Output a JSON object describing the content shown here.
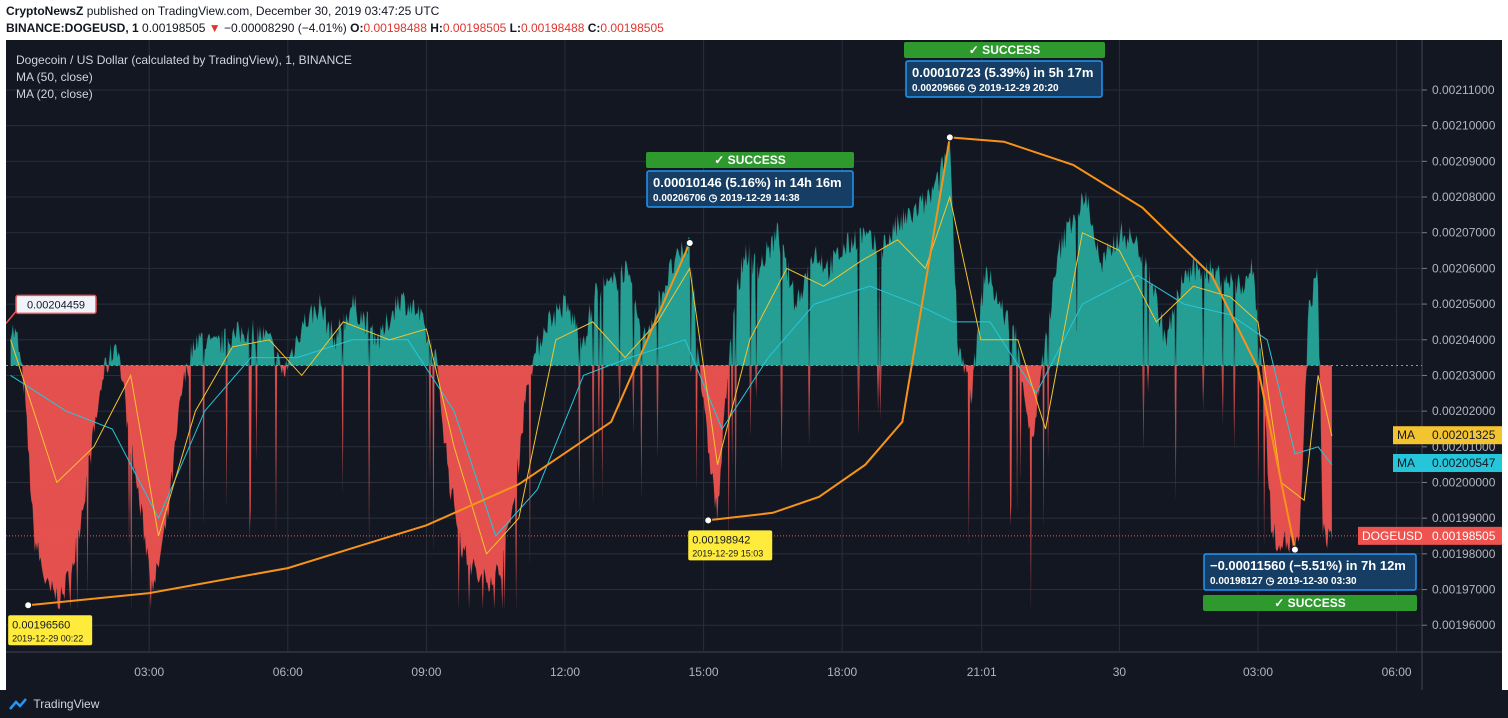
{
  "header": {
    "line1": {
      "author": "CryptoNewsZ",
      "published_text": "published on TradingView.com, December 30, 2019 03:47:25 UTC"
    },
    "line2": {
      "symbol": "BINANCE:DOGEUSD, 1",
      "last": "0.00198505",
      "arrow": "▼",
      "change": "−0.00008290 (−4.01%)",
      "o_label": "O:",
      "o_val": "0.00198488",
      "h_label": "H:",
      "h_val": "0.00198505",
      "l_label": "L:",
      "l_val": "0.00198488",
      "c_label": "C:",
      "c_val": "0.00198505"
    }
  },
  "legend": {
    "title": "Dogecoin / US Dollar (calculated by TradingView), 1, BINANCE",
    "ma1": "MA (50, close)",
    "ma2": "MA (20, close)"
  },
  "footer": {
    "brand": "TradingView"
  },
  "colors": {
    "background": "#131722",
    "grid": "#2a2e39",
    "up_fill": "#26a69a",
    "down_fill": "#ef5350",
    "ma50": "#26c6da",
    "ma20": "#f4c430",
    "trend": "#f7931a",
    "callout": "#163d63",
    "callout_border": "#2196f3",
    "success": "#2e9a2e",
    "yellow_label": "#ffeb3b"
  },
  "chart_data": {
    "type": "area",
    "baseline": 0.0020328,
    "ylim": [
      0.0019525,
      0.002124
    ],
    "xlim": [
      -0.1,
      30.55
    ],
    "y_ticks": [
      "0.00196000",
      "0.00197000",
      "0.00198000",
      "0.00199000",
      "0.00200000",
      "0.00201000",
      "0.00202000",
      "0.00203000",
      "0.00204000",
      "0.00205000",
      "0.00206000",
      "0.00207000",
      "0.00208000",
      "0.00209000",
      "0.00210000",
      "0.00211000"
    ],
    "x_ticks": [
      {
        "label": "03:00",
        "h": 3
      },
      {
        "label": "06:00",
        "h": 6
      },
      {
        "label": "09:00",
        "h": 9
      },
      {
        "label": "12:00",
        "h": 12
      },
      {
        "label": "15:00",
        "h": 15
      },
      {
        "label": "18:00",
        "h": 18
      },
      {
        "label": "21:01",
        "h": 21.02
      },
      {
        "label": "30",
        "h": 24
      },
      {
        "label": "03:00",
        "h": 27
      },
      {
        "label": "06:00",
        "h": 30
      }
    ],
    "price_path": [
      [
        0.0,
        0.002044
      ],
      [
        0.15,
        0.00204
      ],
      [
        0.3,
        0.002025
      ],
      [
        0.5,
        0.001985
      ],
      [
        0.8,
        0.00197
      ],
      [
        1.1,
        0.001967
      ],
      [
        1.4,
        0.00198
      ],
      [
        1.7,
        0.002005
      ],
      [
        2.0,
        0.00203
      ],
      [
        2.3,
        0.00204
      ],
      [
        2.6,
        0.00201
      ],
      [
        2.9,
        0.001985
      ],
      [
        3.1,
        0.00197
      ],
      [
        3.4,
        0.00199
      ],
      [
        3.7,
        0.002025
      ],
      [
        4.0,
        0.002041
      ],
      [
        4.4,
        0.002038
      ],
      [
        4.8,
        0.002041
      ],
      [
        5.2,
        0.002043
      ],
      [
        5.6,
        0.00204
      ],
      [
        5.9,
        0.00203
      ],
      [
        6.3,
        0.002044
      ],
      [
        6.7,
        0.00205
      ],
      [
        7.0,
        0.00204
      ],
      [
        7.4,
        0.00205
      ],
      [
        7.7,
        0.002045
      ],
      [
        8.0,
        0.00204
      ],
      [
        8.4,
        0.002052
      ],
      [
        8.8,
        0.002048
      ],
      [
        9.2,
        0.002035
      ],
      [
        9.5,
        0.002
      ],
      [
        9.8,
        0.00198
      ],
      [
        10.2,
        0.001972
      ],
      [
        10.6,
        0.001975
      ],
      [
        10.9,
        0.001995
      ],
      [
        11.2,
        0.00203
      ],
      [
        11.6,
        0.002045
      ],
      [
        12.0,
        0.00205
      ],
      [
        12.4,
        0.00204
      ],
      [
        12.7,
        0.002055
      ],
      [
        13.0,
        0.002055
      ],
      [
        13.3,
        0.00206
      ],
      [
        13.7,
        0.00204
      ],
      [
        14.0,
        0.00205
      ],
      [
        14.3,
        0.00206
      ],
      [
        14.7,
        0.002067
      ],
      [
        15.0,
        0.00202
      ],
      [
        15.3,
        0.00199
      ],
      [
        15.6,
        0.002045
      ],
      [
        15.9,
        0.002065
      ],
      [
        16.2,
        0.00206
      ],
      [
        16.6,
        0.00207
      ],
      [
        17.0,
        0.00205
      ],
      [
        17.4,
        0.002065
      ],
      [
        17.7,
        0.00206
      ],
      [
        18.0,
        0.002065
      ],
      [
        18.4,
        0.00207
      ],
      [
        18.8,
        0.002065
      ],
      [
        19.2,
        0.002072
      ],
      [
        19.5,
        0.002075
      ],
      [
        19.9,
        0.00208
      ],
      [
        20.1,
        0.002085
      ],
      [
        20.33,
        0.002097
      ],
      [
        20.5,
        0.00204
      ],
      [
        20.8,
        0.002025
      ],
      [
        21.1,
        0.00206
      ],
      [
        21.4,
        0.00205
      ],
      [
        21.8,
        0.00204
      ],
      [
        22.1,
        0.00201
      ],
      [
        22.4,
        0.00204
      ],
      [
        22.7,
        0.002065
      ],
      [
        23.0,
        0.002075
      ],
      [
        23.3,
        0.00208
      ],
      [
        23.6,
        0.00206
      ],
      [
        24.0,
        0.00207
      ],
      [
        24.3,
        0.002068
      ],
      [
        24.6,
        0.002062
      ],
      [
        25.0,
        0.00204
      ],
      [
        25.4,
        0.002058
      ],
      [
        25.8,
        0.00206
      ],
      [
        26.2,
        0.002058
      ],
      [
        26.6,
        0.002055
      ],
      [
        26.9,
        0.00206
      ],
      [
        27.1,
        0.00203
      ],
      [
        27.3,
        0.001985
      ],
      [
        27.6,
        0.001983
      ],
      [
        27.9,
        0.001982
      ],
      [
        28.1,
        0.00205
      ],
      [
        28.3,
        0.002058
      ],
      [
        28.4,
        0.001985
      ],
      [
        28.6,
        0.001985
      ]
    ],
    "ma20_path": [
      [
        0.0,
        0.00204
      ],
      [
        1.0,
        0.002
      ],
      [
        1.8,
        0.00201
      ],
      [
        2.6,
        0.00203
      ],
      [
        3.2,
        0.001985
      ],
      [
        4.0,
        0.00202
      ],
      [
        4.8,
        0.002038
      ],
      [
        5.6,
        0.00204
      ],
      [
        6.3,
        0.00203
      ],
      [
        7.2,
        0.002045
      ],
      [
        8.2,
        0.00204
      ],
      [
        9.0,
        0.002043
      ],
      [
        9.6,
        0.00201
      ],
      [
        10.3,
        0.00198
      ],
      [
        11.0,
        0.00199
      ],
      [
        11.8,
        0.00204
      ],
      [
        12.6,
        0.002045
      ],
      [
        13.3,
        0.002035
      ],
      [
        14.0,
        0.002045
      ],
      [
        14.7,
        0.00206
      ],
      [
        15.3,
        0.002005
      ],
      [
        16.0,
        0.00204
      ],
      [
        16.8,
        0.00206
      ],
      [
        17.6,
        0.002055
      ],
      [
        18.4,
        0.002062
      ],
      [
        19.2,
        0.002068
      ],
      [
        19.8,
        0.00206
      ],
      [
        20.33,
        0.00208
      ],
      [
        21.0,
        0.00204
      ],
      [
        21.8,
        0.00204
      ],
      [
        22.4,
        0.002015
      ],
      [
        23.2,
        0.00207
      ],
      [
        24.0,
        0.002065
      ],
      [
        24.8,
        0.002045
      ],
      [
        25.6,
        0.002055
      ],
      [
        26.4,
        0.002052
      ],
      [
        27.0,
        0.002045
      ],
      [
        27.5,
        0.002
      ],
      [
        28.0,
        0.001995
      ],
      [
        28.3,
        0.00203
      ],
      [
        28.6,
        0.002013
      ]
    ],
    "ma50_path": [
      [
        0.0,
        0.00203
      ],
      [
        1.2,
        0.00202
      ],
      [
        2.2,
        0.002015
      ],
      [
        3.2,
        0.00199
      ],
      [
        4.2,
        0.00202
      ],
      [
        5.2,
        0.002035
      ],
      [
        6.2,
        0.002035
      ],
      [
        7.4,
        0.00204
      ],
      [
        8.6,
        0.00204
      ],
      [
        9.6,
        0.00202
      ],
      [
        10.5,
        0.001985
      ],
      [
        11.4,
        0.001998
      ],
      [
        12.4,
        0.00203
      ],
      [
        13.4,
        0.002035
      ],
      [
        14.6,
        0.00204
      ],
      [
        15.4,
        0.002015
      ],
      [
        16.4,
        0.002035
      ],
      [
        17.4,
        0.00205
      ],
      [
        18.6,
        0.002055
      ],
      [
        19.6,
        0.00205
      ],
      [
        20.4,
        0.002045
      ],
      [
        21.2,
        0.002045
      ],
      [
        22.2,
        0.002025
      ],
      [
        23.2,
        0.00205
      ],
      [
        24.4,
        0.002058
      ],
      [
        25.4,
        0.00205
      ],
      [
        26.4,
        0.002047
      ],
      [
        27.2,
        0.00204
      ],
      [
        27.8,
        0.002008
      ],
      [
        28.3,
        0.00201
      ],
      [
        28.6,
        0.002005
      ]
    ],
    "trend_segments": [
      [
        [
          0.38,
          0.0019656
        ],
        [
          3.0,
          0.001969
        ],
        [
          6.0,
          0.001976
        ],
        [
          9.0,
          0.001988
        ],
        [
          11.0,
          0.0019995
        ],
        [
          13.0,
          0.002017
        ],
        [
          14.7,
          0.0020671
        ]
      ],
      [
        [
          15.1,
          0.0019894
        ],
        [
          16.5,
          0.0019915
        ],
        [
          17.5,
          0.001996
        ],
        [
          18.5,
          0.002005
        ],
        [
          19.3,
          0.002017
        ],
        [
          20.33,
          0.0020967
        ]
      ],
      [
        [
          20.33,
          0.0020967
        ],
        [
          21.5,
          0.0020955
        ],
        [
          23.0,
          0.002089
        ],
        [
          24.5,
          0.002077
        ],
        [
          26.0,
          0.002058
        ],
        [
          27.0,
          0.002032
        ],
        [
          27.8,
          0.0019812
        ]
      ]
    ],
    "points": [
      {
        "h": 0.38,
        "y": 0.0019656
      },
      {
        "h": 14.7,
        "y": 0.0020671
      },
      {
        "h": 15.1,
        "y": 0.0019894
      },
      {
        "h": 20.33,
        "y": 0.0020967
      },
      {
        "h": 27.8,
        "y": 0.0019812
      }
    ],
    "price_labels": [
      {
        "text": "0.00204459",
        "h": 0.1,
        "y": 0.0020446,
        "type": "left-tag"
      },
      {
        "value": "0.00196560",
        "date": "2019-12-29 00:22",
        "h": 0.38,
        "y": 0.0019656,
        "type": "yellow"
      },
      {
        "value": "0.00198942",
        "date": "2019-12-29 15:03",
        "h": 15.1,
        "y": 0.0019894,
        "type": "yellow"
      }
    ],
    "callouts": [
      {
        "line1": "0.00010146 (5.16%) in 14h 16m",
        "line2": "0.00206706 ◷ 2019-12-29  14:38",
        "success": "✓ SUCCESS",
        "placement": "above"
      },
      {
        "line1": "0.00010723 (5.39%) in 5h 17m",
        "line2": "0.00209666 ◷ 2019-12-29  20:20",
        "success": "✓ SUCCESS",
        "placement": "top"
      },
      {
        "line1": "−0.00011560 (−5.51%) in 7h 12m",
        "line2": "0.00198127 ◷ 2019-12-30  03:30",
        "success": "✓ SUCCESS",
        "placement": "below"
      }
    ],
    "axis_tags": [
      {
        "label": "MA",
        "value": "0.00201325",
        "y": 0.00201325,
        "color": "#f4c430"
      },
      {
        "label": "MA",
        "value": "0.00200547",
        "y": 0.00200547,
        "color": "#26c6da"
      },
      {
        "label": "DOGEUSD",
        "value": "0.00198505",
        "y": 0.00198505,
        "color": "#ef5350"
      }
    ]
  }
}
